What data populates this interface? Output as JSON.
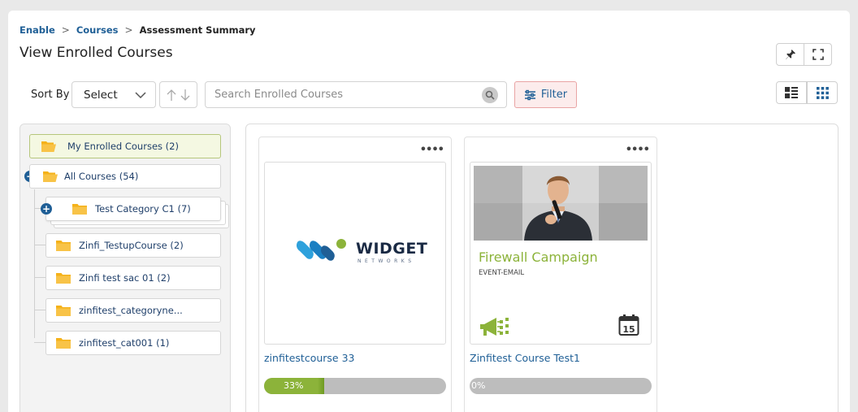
{
  "breadcrumb": {
    "item1": "Enable",
    "item2": "Courses",
    "item3": "Assessment Summary",
    "separator": ">"
  },
  "page": {
    "title": "View Enrolled Courses"
  },
  "toolbar": {
    "sort_label": "Sort By",
    "sort_value": "Select",
    "search_placeholder": "Search Enrolled Courses",
    "filter_label": "Filter"
  },
  "tree": {
    "my_enrolled": "My Enrolled Courses (2)",
    "all_courses": "All Courses (54)",
    "children": [
      "Test Category C1 (7)",
      "Zinfi_TestupCourse (2)",
      "Zinfi test sac 01 (2)",
      "zinfitest_categoryne...",
      "zinfitest_cat001 (1)"
    ]
  },
  "courses": [
    {
      "title": "zinfitestcourse 33",
      "progress": 0.33,
      "progress_label": "33%",
      "logo_word": "WIDGET",
      "logo_sub": "NETWORKS"
    },
    {
      "title": "Zinfitest Course Test1",
      "progress": 0.0,
      "progress_label": "0%",
      "banner_title": "Firewall Campaign",
      "banner_sub": "EVENT-EMAIL",
      "calendar_day": "15"
    }
  ],
  "colors": {
    "accent_blue": "#1f5f96",
    "accent_green": "#8cb33a",
    "filter_bg": "#fcecec",
    "folder": "#f5b21a"
  },
  "icons": [
    "pin-icon",
    "fullscreen-icon",
    "chevron-down-icon",
    "sort-asc-icon",
    "sort-desc-icon",
    "search-icon",
    "filter-icon",
    "list-view-icon",
    "grid-view-icon",
    "folder-open-icon",
    "folder-icon",
    "collapse-icon",
    "expand-icon",
    "more-icon",
    "megaphone-icon",
    "calendar-icon"
  ]
}
